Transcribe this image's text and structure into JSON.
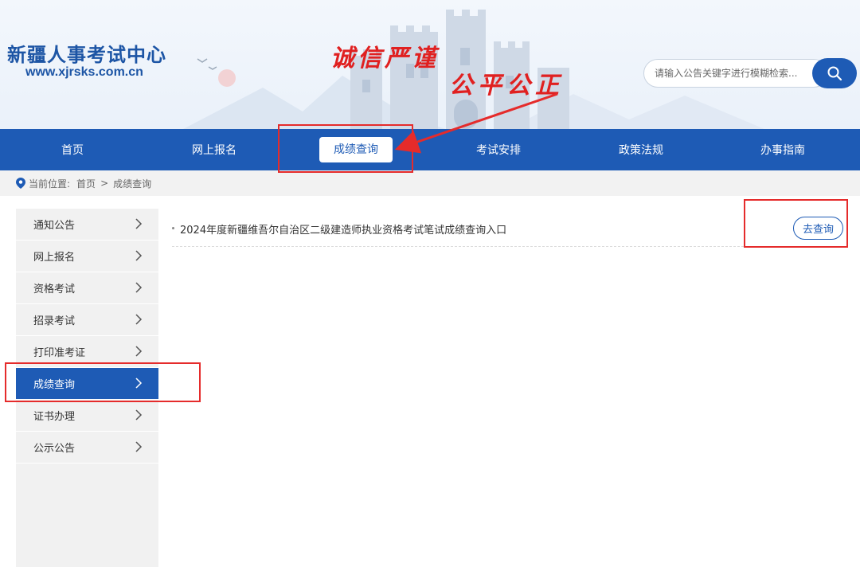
{
  "header": {
    "site_title": "新疆人事考试中心",
    "site_url": "www.xjrsks.com.cn",
    "slogan_line1": "诚信严谨",
    "slogan_line2": "公平公正",
    "search": {
      "placeholder": "请输入公告关键字进行模糊检索...",
      "value": "",
      "button_icon": "search-icon"
    }
  },
  "nav": {
    "items": [
      {
        "label": "首页",
        "active": false
      },
      {
        "label": "网上报名",
        "active": false
      },
      {
        "label": "成绩查询",
        "active": true
      },
      {
        "label": "考试安排",
        "active": false
      },
      {
        "label": "政策法规",
        "active": false
      },
      {
        "label": "办事指南",
        "active": false
      }
    ]
  },
  "breadcrumb": {
    "icon": "location-pin-icon",
    "prefix": "当前位置:",
    "home": "首页",
    "separator": ">",
    "current": "成绩查询"
  },
  "sidebar": {
    "items": [
      {
        "label": "通知公告",
        "active": false
      },
      {
        "label": "网上报名",
        "active": false
      },
      {
        "label": "资格考试",
        "active": false
      },
      {
        "label": "招录考试",
        "active": false
      },
      {
        "label": "打印准考证",
        "active": false
      },
      {
        "label": "成绩查询",
        "active": true
      },
      {
        "label": "证书办理",
        "active": false
      },
      {
        "label": "公示公告",
        "active": false
      }
    ]
  },
  "content": {
    "items": [
      {
        "title": "2024年度新疆维吾尔自治区二级建造师执业资格考试笔试成绩查询入口",
        "action_label": "去查询"
      }
    ]
  },
  "colors": {
    "brand_blue": "#1e5bb5",
    "annotation_red": "#e52b2b",
    "slogan_red": "#e02020"
  }
}
